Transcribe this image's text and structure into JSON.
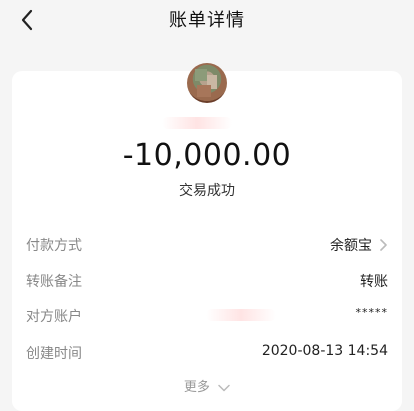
{
  "header": {
    "title": "账单详情"
  },
  "transaction": {
    "amount": "-10,000.00",
    "status": "交易成功"
  },
  "details": [
    {
      "label": "付款方式",
      "value": "余额宝"
    },
    {
      "label": "转账备注",
      "value": "转账"
    },
    {
      "label": "对方账户",
      "value": "*****"
    },
    {
      "label": "创建时间",
      "value": "2020-08-13 14:54"
    }
  ],
  "footer": {
    "more_label": "更多"
  },
  "icons": {
    "back": "chevron-left-icon",
    "row_chevron": "chevron-right-icon",
    "more": "chevron-down-icon"
  },
  "colors": {
    "background": "#f5f5f5",
    "card": "#ffffff",
    "label": "#888888",
    "text": "#222222"
  }
}
